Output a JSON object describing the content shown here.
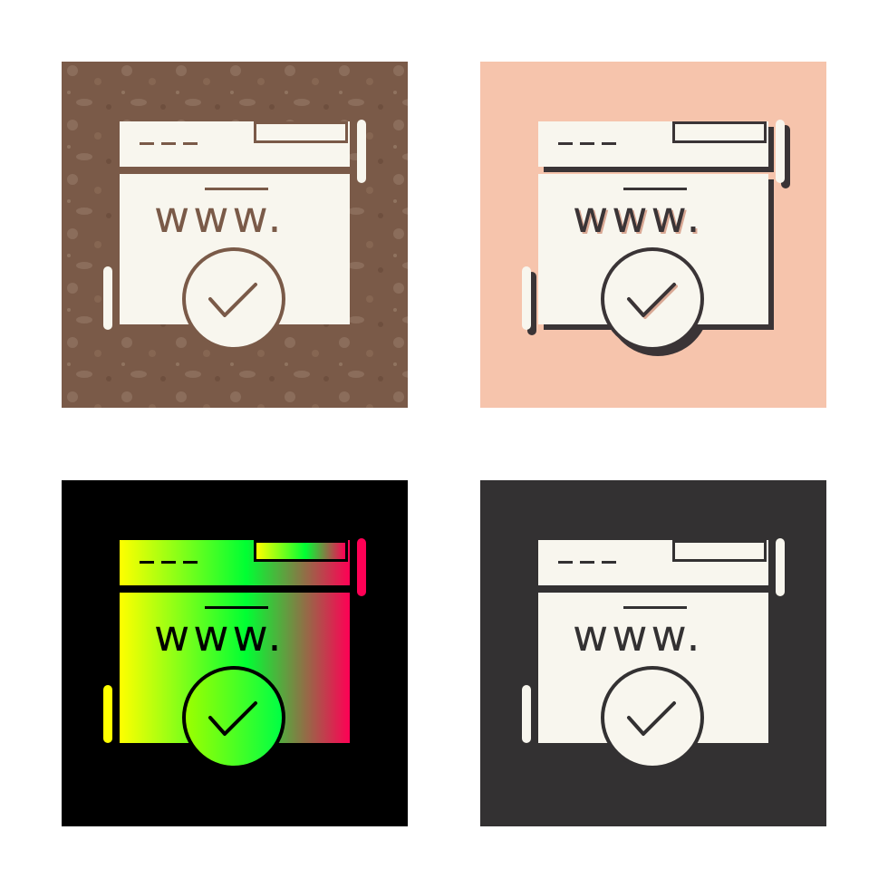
{
  "icon_set": {
    "subject": "website-verified-icon",
    "url_text": "www.",
    "variants": [
      {
        "style": "glyph-textured",
        "background": "#7a5a48",
        "foreground": "#f8f6ee",
        "line": "#7a5a48"
      },
      {
        "style": "glyph-shadow",
        "background": "#f6c4ac",
        "foreground": "#f8f6ee",
        "line": "#3a3436"
      },
      {
        "style": "glyph-gradient",
        "background": "#000000",
        "gradient": [
          "#ffff00",
          "#00ff33",
          "#ff0055"
        ],
        "line": "#000000"
      },
      {
        "style": "glyph-solid",
        "background": "#333132",
        "foreground": "#f8f6ee",
        "line": "#333132"
      }
    ]
  }
}
